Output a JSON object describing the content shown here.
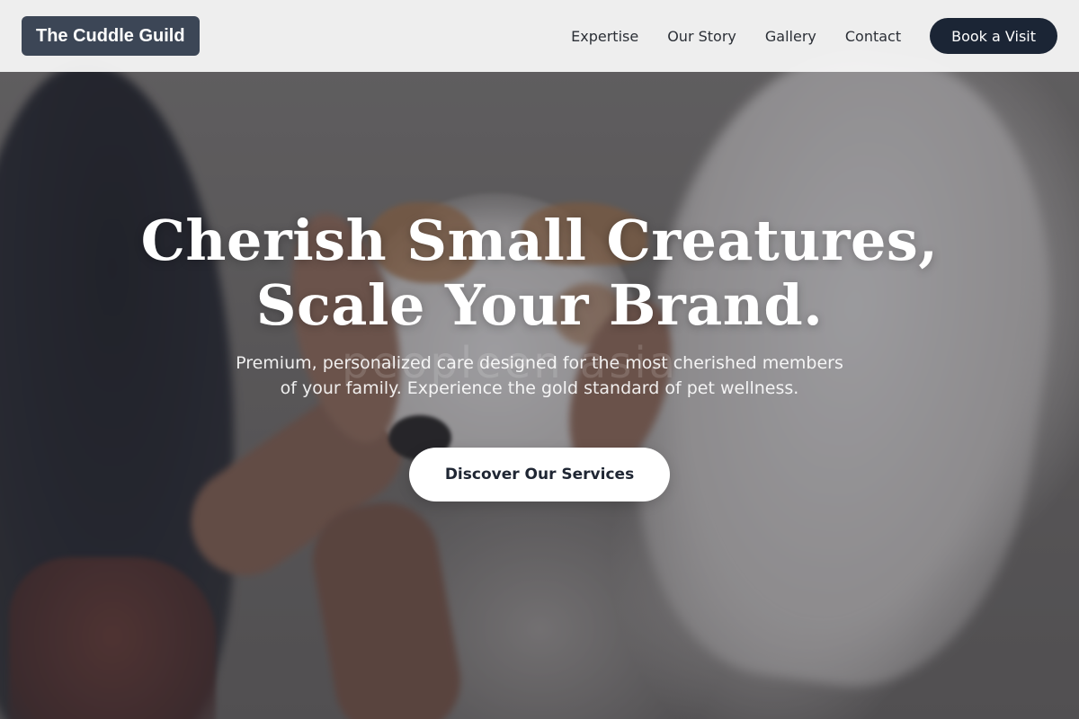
{
  "header": {
    "logo": "The Cuddle Guild",
    "nav": [
      {
        "label": "Expertise"
      },
      {
        "label": "Our Story"
      },
      {
        "label": "Gallery"
      },
      {
        "label": "Contact"
      }
    ],
    "cta_label": "Book a Visit"
  },
  "hero": {
    "title_line1": "Cherish Small Creatures,",
    "title_line2": "Scale Your Brand.",
    "subtitle_line1": "Premium, personalized care designed for the most cherished members",
    "subtitle_line2": "of your family. Experience the gold standard of pet wellness.",
    "cta_label": "Discover Our Services",
    "watermark": "peopleen asia"
  },
  "colors": {
    "header_bg": "#f3f3f3",
    "logo_bg": "#3c4656",
    "primary_button": "#1b2535",
    "cta_button_bg": "#ffffff",
    "nav_text": "#2b2f36"
  }
}
